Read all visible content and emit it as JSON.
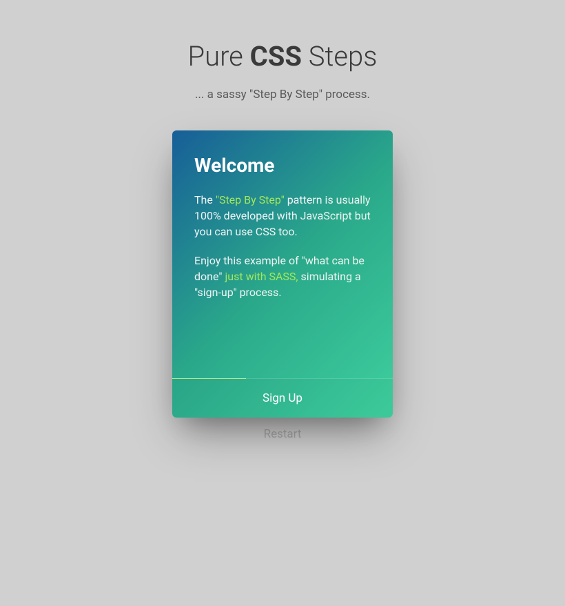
{
  "header": {
    "title_pre": "Pure ",
    "title_bold": "CSS",
    "title_post": " Steps",
    "subtitle": "... a sassy \"Step By Step\" process."
  },
  "card": {
    "heading": "Welcome",
    "p1_pre": "The ",
    "p1_highlight": "\"Step By Step\"",
    "p1_post": " pattern is usually 100% developed with JavaScript but you can use CSS too.",
    "p2_pre": "Enjoy this example of \"what can be done\" ",
    "p2_highlight": "just with SASS,",
    "p2_post": " simulating a \"sign-up\" process.",
    "action": "Sign Up"
  },
  "footer": {
    "restart": "Restart"
  }
}
